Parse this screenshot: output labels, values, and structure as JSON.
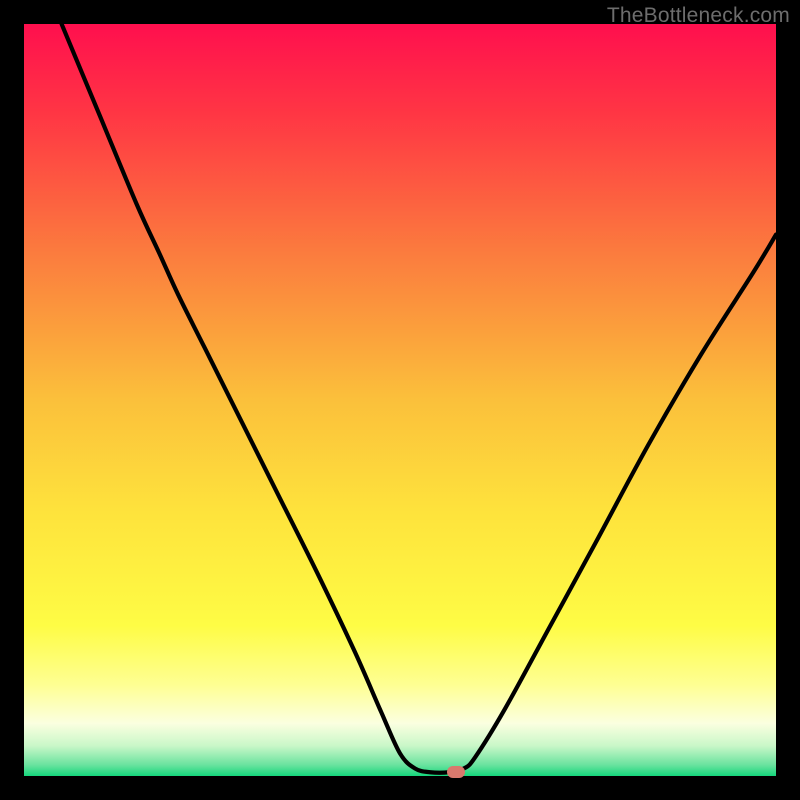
{
  "watermark": "TheBottleneck.com",
  "chart_data": {
    "type": "line",
    "title": "",
    "xlabel": "",
    "ylabel": "",
    "xlim": [
      0,
      100
    ],
    "ylim": [
      0,
      100
    ],
    "gradient_stops": [
      {
        "offset": 0.0,
        "color": "#ff0f4e"
      },
      {
        "offset": 0.12,
        "color": "#ff3644"
      },
      {
        "offset": 0.3,
        "color": "#fb7a3e"
      },
      {
        "offset": 0.5,
        "color": "#fbc03b"
      },
      {
        "offset": 0.65,
        "color": "#fee33c"
      },
      {
        "offset": 0.8,
        "color": "#fefc45"
      },
      {
        "offset": 0.88,
        "color": "#feff94"
      },
      {
        "offset": 0.93,
        "color": "#fbffe0"
      },
      {
        "offset": 0.96,
        "color": "#c9f7c8"
      },
      {
        "offset": 0.985,
        "color": "#6be39f"
      },
      {
        "offset": 1.0,
        "color": "#15d67c"
      }
    ],
    "series": [
      {
        "name": "bottleneck-curve",
        "color": "#000000",
        "points": [
          {
            "x": 5.0,
            "y": 100.0
          },
          {
            "x": 10.0,
            "y": 88.0
          },
          {
            "x": 15.0,
            "y": 76.0
          },
          {
            "x": 18.0,
            "y": 69.5
          },
          {
            "x": 20.5,
            "y": 64.0
          },
          {
            "x": 24.0,
            "y": 57.0
          },
          {
            "x": 29.0,
            "y": 47.0
          },
          {
            "x": 34.0,
            "y": 37.0
          },
          {
            "x": 39.0,
            "y": 27.0
          },
          {
            "x": 44.0,
            "y": 16.5
          },
          {
            "x": 47.5,
            "y": 8.5
          },
          {
            "x": 50.0,
            "y": 3.0
          },
          {
            "x": 52.0,
            "y": 1.0
          },
          {
            "x": 54.0,
            "y": 0.5
          },
          {
            "x": 56.5,
            "y": 0.5
          },
          {
            "x": 58.5,
            "y": 1.0
          },
          {
            "x": 60.0,
            "y": 2.5
          },
          {
            "x": 64.0,
            "y": 9.0
          },
          {
            "x": 70.0,
            "y": 20.0
          },
          {
            "x": 76.0,
            "y": 31.0
          },
          {
            "x": 83.0,
            "y": 44.0
          },
          {
            "x": 90.0,
            "y": 56.0
          },
          {
            "x": 97.0,
            "y": 67.0
          },
          {
            "x": 100.0,
            "y": 72.0
          }
        ]
      }
    ],
    "marker": {
      "x": 57.5,
      "y": 0.5,
      "color": "#d9796d"
    }
  }
}
